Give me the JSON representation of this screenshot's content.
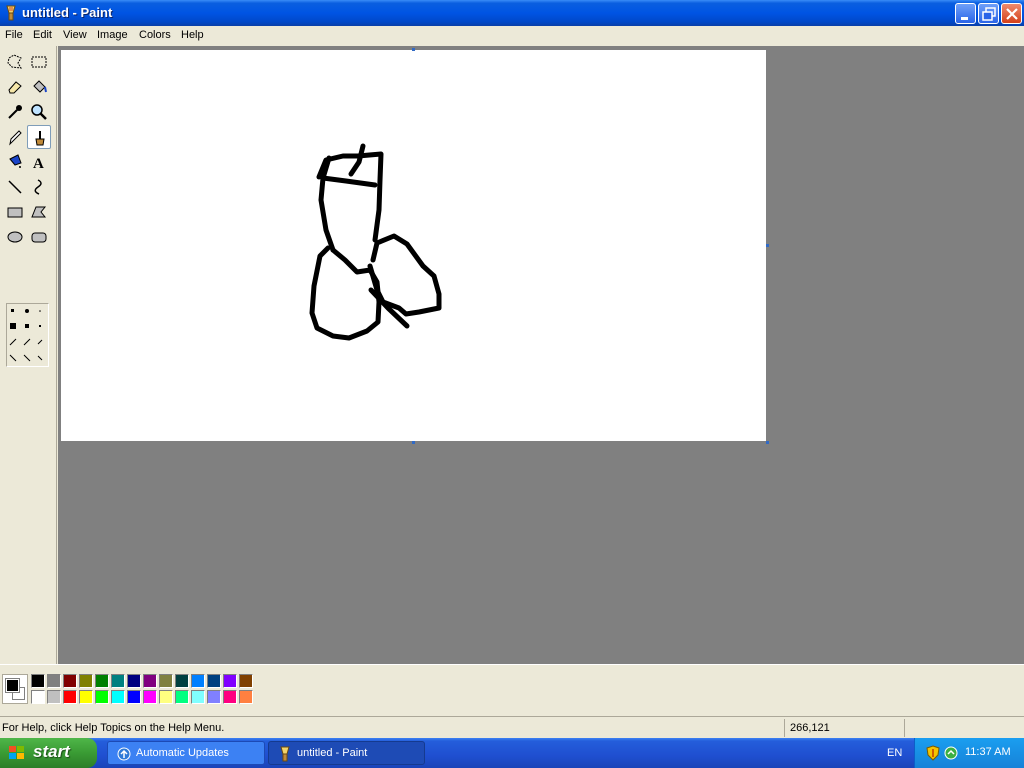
{
  "window": {
    "title": "untitled - Paint",
    "app_icon": "paint-icon",
    "buttons": [
      "minimize-icon",
      "maximize-icon",
      "close-icon"
    ]
  },
  "menu": [
    "File",
    "Edit",
    "View",
    "Image",
    "Colors",
    "Help"
  ],
  "toolbox": {
    "tools": [
      "free-form-select",
      "select",
      "eraser",
      "fill-with-color",
      "pick-color",
      "magnifier",
      "pencil",
      "brush",
      "airbrush",
      "text",
      "line",
      "curve",
      "rectangle",
      "polygon",
      "ellipse",
      "rounded-rectangle"
    ],
    "selected_tool": "brush"
  },
  "palette": {
    "foreground": "#000000",
    "background": "#ffffff",
    "colors_top": [
      "#000000",
      "#808080",
      "#800000",
      "#808000",
      "#008000",
      "#008080",
      "#000080",
      "#800080",
      "#808040",
      "#004040",
      "#0080ff",
      "#004080",
      "#8000ff",
      "#804000"
    ],
    "colors_bottom": [
      "#ffffff",
      "#c0c0c0",
      "#ff0000",
      "#ffff00",
      "#00ff00",
      "#00ffff",
      "#0000ff",
      "#ff00ff",
      "#ffff80",
      "#00ff80",
      "#80ffff",
      "#8080ff",
      "#ff0080",
      "#ff8040"
    ]
  },
  "status": {
    "help_text": "For Help, click Help Topics on the Help Menu.",
    "coordinates": "266,121"
  },
  "taskbar": {
    "start_label": "start",
    "tasks": [
      {
        "label": "Automatic Updates",
        "icon": "windows-update-icon",
        "active": false
      },
      {
        "label": "untitled - Paint",
        "icon": "paint-icon",
        "active": true
      }
    ],
    "language": "EN",
    "clock": "11:37 AM"
  }
}
